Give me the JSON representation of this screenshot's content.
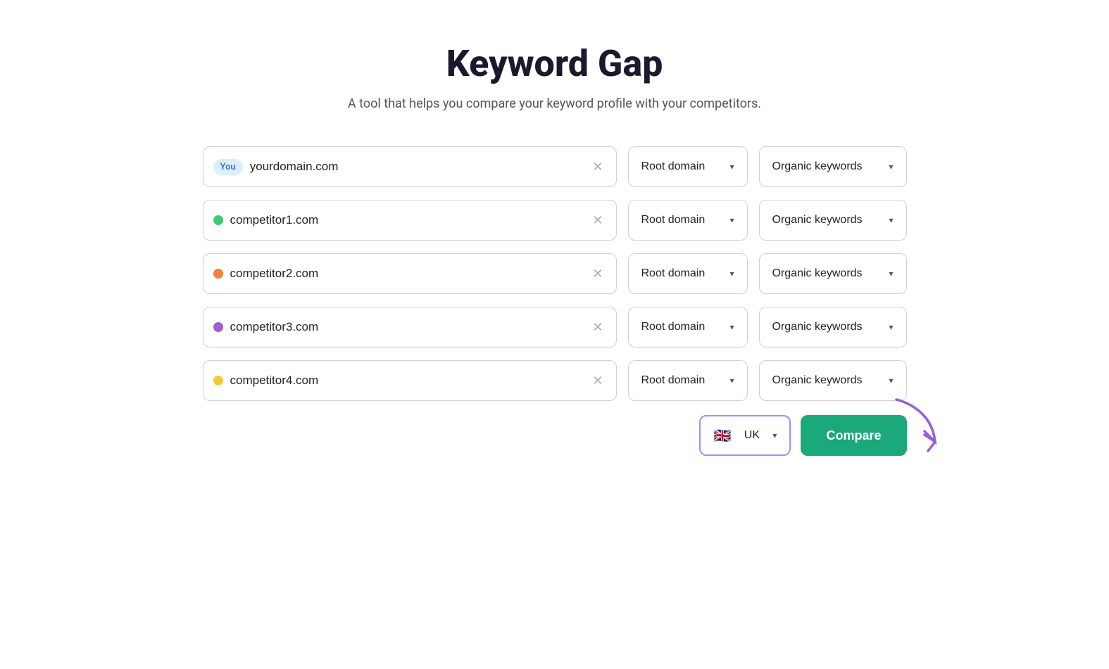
{
  "header": {
    "title": "Keyword Gap",
    "subtitle": "A tool that helps you compare your keyword profile with your competitors."
  },
  "rows": [
    {
      "id": "you",
      "badge": "You",
      "dot_color": null,
      "placeholder": "yourdomain.com",
      "value": "yourdomain.com",
      "domain_type": "Root domain",
      "keyword_type": "Organic keywords"
    },
    {
      "id": "comp1",
      "badge": null,
      "dot_color": "#3ec97c",
      "placeholder": "competitor1.com",
      "value": "competitor1.com",
      "domain_type": "Root domain",
      "keyword_type": "Organic keywords"
    },
    {
      "id": "comp2",
      "badge": null,
      "dot_color": "#f5823a",
      "placeholder": "competitor2.com",
      "value": "competitor2.com",
      "domain_type": "Root domain",
      "keyword_type": "Organic keywords"
    },
    {
      "id": "comp3",
      "badge": null,
      "dot_color": "#9b5fd4",
      "placeholder": "competitor3.com",
      "value": "competitor3.com",
      "domain_type": "Root domain",
      "keyword_type": "Organic keywords"
    },
    {
      "id": "comp4",
      "badge": null,
      "dot_color": "#f5c842",
      "placeholder": "competitor4.com",
      "value": "competitor4.com",
      "domain_type": "Root domain",
      "keyword_type": "Organic keywords"
    }
  ],
  "bottom": {
    "country_flag": "🇬🇧",
    "country_label": "UK",
    "compare_label": "Compare"
  }
}
